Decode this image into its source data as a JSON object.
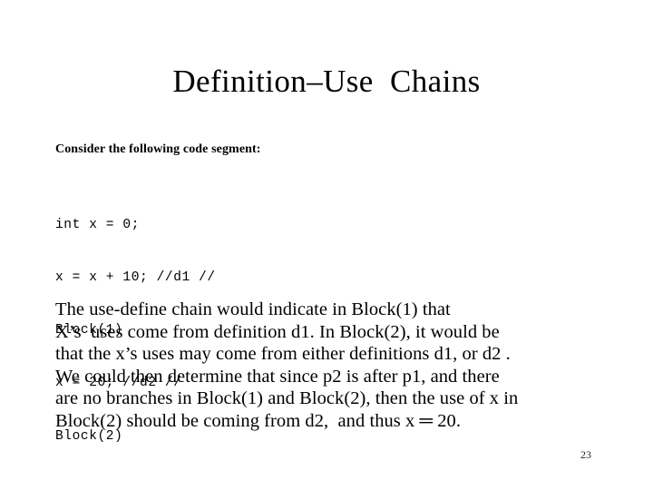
{
  "slide": {
    "title": "Definition–Use  Chains",
    "intro": "Consider the following code segment:",
    "code_lines": [
      "int x = 0;",
      "x = x + 10; //d1 //",
      "Block(1)",
      "x = 20; //d2 //",
      "Block(2)"
    ],
    "body_lines": [
      "The use-define chain would indicate in Block(1) that",
      "X’s  uses come from definition d1. In Block(2), it would be",
      "that the x’s uses may come from either definitions d1, or d2 .",
      "We could then determine that since p2 is after p1, and there",
      "are no branches in Block(1) and Block(2), then the use of x in",
      "Block(2) should be coming from d2,  and thus x ═ 20."
    ],
    "page_number": "23",
    "colors": {
      "background": "#ffffff",
      "text": "#000000",
      "page_number": "#2b2b2b"
    }
  }
}
